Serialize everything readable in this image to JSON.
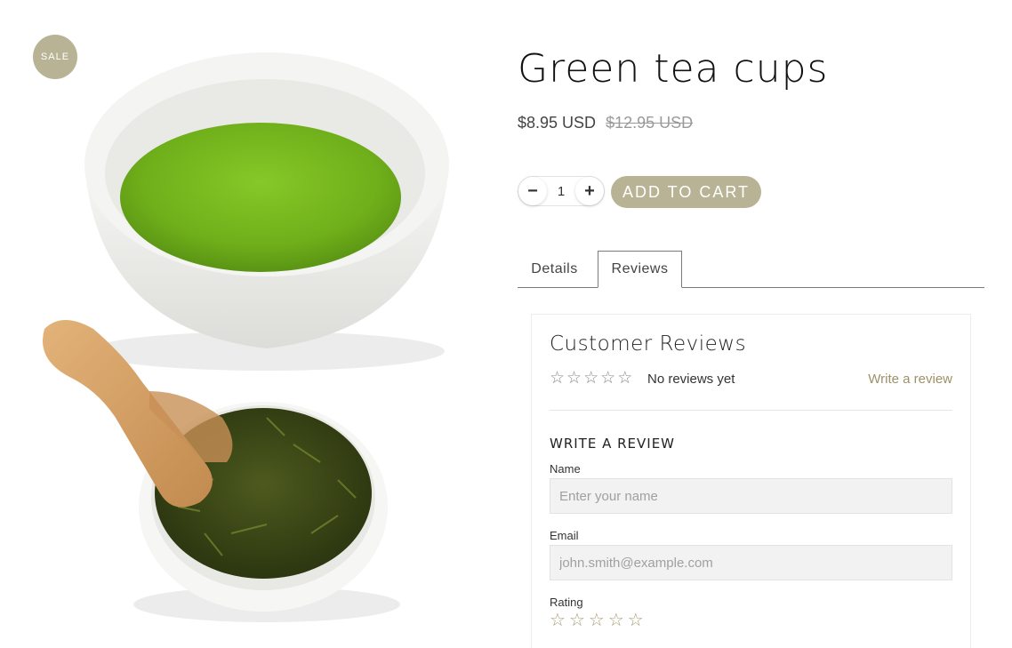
{
  "product": {
    "badge": "SALE",
    "title": "Green tea cups",
    "price": "$8.95 USD",
    "compare_price": "$12.95 USD",
    "image_alt_icon": "green-tea-cup-and-leaves-image"
  },
  "cart": {
    "minus_label": "−",
    "plus_label": "+",
    "quantity": "1",
    "add_to_cart_label": "ADD TO CART"
  },
  "tabs": [
    {
      "label": "Details",
      "active": false
    },
    {
      "label": "Reviews",
      "active": true
    }
  ],
  "reviews": {
    "title": "Customer Reviews",
    "average_rating": 0,
    "max_rating": 5,
    "star_glyph": "☆",
    "no_reviews_text": "No reviews yet",
    "write_review_link": "Write a review",
    "form": {
      "heading": "WRITE A REVIEW",
      "name_label": "Name",
      "name_placeholder": "Enter your name",
      "email_label": "Email",
      "email_placeholder": "john.smith@example.com",
      "rating_label": "Rating",
      "rating_value": 0
    }
  },
  "colors": {
    "accent": "#b8b394",
    "link": "#9e9067",
    "star": "#a79c72",
    "tea_green": "#7fbf1f"
  }
}
